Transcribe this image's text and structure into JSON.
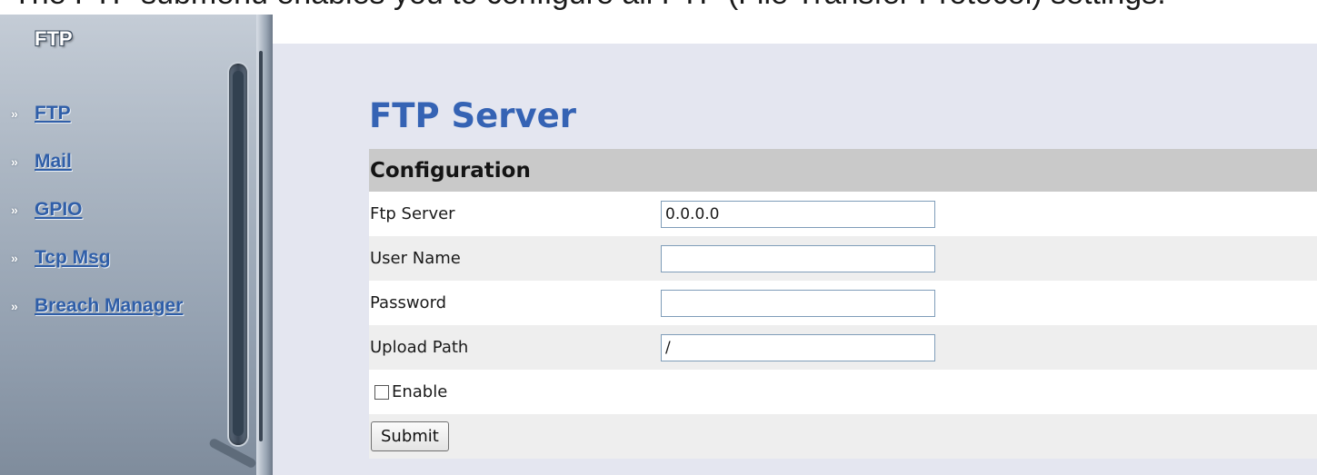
{
  "caption": "The FTP submenu enables you to configure all FTP (File Transfer Protocol) settings.",
  "sidebar": {
    "title": "FTP",
    "bullet": "»",
    "items": [
      {
        "label": "FTP"
      },
      {
        "label": "Mail"
      },
      {
        "label": "GPIO"
      },
      {
        "label": "Tcp Msg"
      },
      {
        "label": "Breach Manager"
      }
    ]
  },
  "page": {
    "title": "FTP Server",
    "section": "Configuration",
    "fields": {
      "ftp_server": {
        "label": "Ftp Server",
        "value": "0.0.0.0"
      },
      "user_name": {
        "label": "User Name",
        "value": ""
      },
      "password": {
        "label": "Password",
        "value": ""
      },
      "upload_path": {
        "label": "Upload Path",
        "value": "/"
      }
    },
    "enable_label": "Enable",
    "enable_checked": false,
    "submit_label": "Submit"
  },
  "colors": {
    "title_blue": "#3563b4",
    "link_blue": "#2f5ea8",
    "content_bg": "#e4e6f0",
    "header_gray": "#c9c9c9"
  }
}
